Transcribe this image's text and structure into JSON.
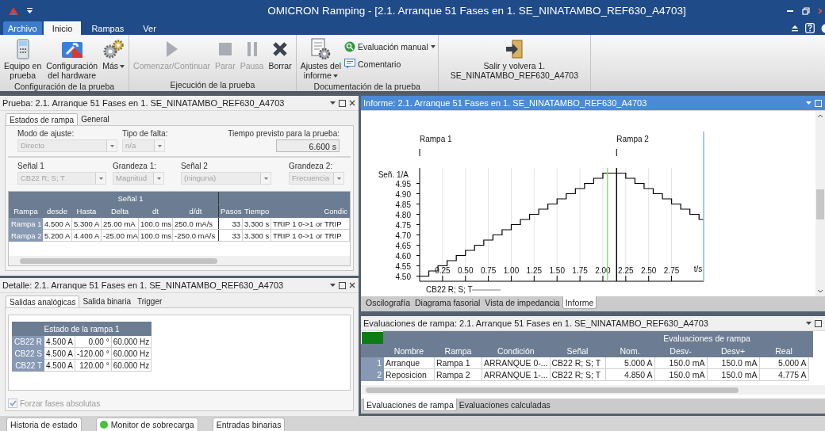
{
  "window": {
    "title": "OMICRON Ramping - [2.1. Arranque 51 Fases en 1. SE_NINATAMBO_REF630_A4703]"
  },
  "ribbon_tabs": [
    {
      "label": "Archivo",
      "kind": "file",
      "selected": false
    },
    {
      "label": "Inicio",
      "kind": "tab",
      "selected": true
    },
    {
      "label": "Rampas",
      "kind": "tab",
      "selected": false
    },
    {
      "label": "Ver",
      "kind": "tab",
      "selected": false
    }
  ],
  "ribbon_groups": [
    {
      "label": "Configuración de la prueba",
      "buttons": [
        {
          "label": "Equipo en\nprueba",
          "kind": "large",
          "disabled": false,
          "dropdown": false
        },
        {
          "label": "Configuración\ndel hardware",
          "kind": "large",
          "disabled": false,
          "dropdown": false
        },
        {
          "label": "Más",
          "kind": "large",
          "disabled": false,
          "dropdown": true
        }
      ]
    },
    {
      "label": "Ejecución de la prueba",
      "buttons": [
        {
          "label": "Comenzar/Continuar",
          "kind": "large",
          "disabled": true,
          "dropdown": false
        },
        {
          "label": "Parar",
          "kind": "large",
          "disabled": true,
          "dropdown": false
        },
        {
          "label": "Pausa",
          "kind": "large",
          "disabled": true,
          "dropdown": false
        },
        {
          "label": "Borrar",
          "kind": "large",
          "disabled": false,
          "dropdown": false
        }
      ]
    },
    {
      "label": "Documentación de la prueba",
      "buttons": [
        {
          "label": "Ajustes del\ninforme",
          "kind": "large",
          "disabled": false,
          "dropdown": true
        },
        {
          "label": "Evaluación manual",
          "kind": "small",
          "disabled": false,
          "dropdown": true
        },
        {
          "label": "Comentario",
          "kind": "small",
          "disabled": false,
          "dropdown": false
        }
      ]
    },
    {
      "buttons": [
        {
          "label": "Salir y volvera 1.\nSE_NINATAMBO_REF630_A4703",
          "kind": "large",
          "disabled": false,
          "dropdown": false
        }
      ]
    }
  ],
  "test_panel": {
    "title": "Prueba: 2.1. Arranque 51 Fases en 1. SE_NINATAMBO_REF630_A4703",
    "active": false,
    "tabs": [
      {
        "label": "Estados de rampa",
        "selected": true
      },
      {
        "label": "General",
        "selected": false
      }
    ],
    "fields_top": [
      {
        "label": "Modo de ajuste:",
        "value": "Directo",
        "kind": "dropdown",
        "disabled": true
      },
      {
        "label": "Tipo de falta:",
        "value": "n/a",
        "kind": "dropdown",
        "disabled": true
      },
      {
        "label": "Tiempo previsto para la prueba:",
        "value": "6.600 s",
        "kind": "readout",
        "disabled": false
      }
    ],
    "fields_bottom": [
      {
        "label": "Señal 1",
        "value": "CB22 R; S; T",
        "kind": "dropdown",
        "disabled": true
      },
      {
        "label": "Grandeza 1:",
        "value": "Magnitud",
        "kind": "dropdown",
        "disabled": true
      },
      {
        "label": "Señal 2",
        "value": "(ninguna)",
        "kind": "dropdown",
        "disabled": true
      },
      {
        "label": "Grandeza 2:",
        "value": "Frecuencia",
        "kind": "dropdown",
        "disabled": true
      }
    ],
    "ramp_table": {
      "group_header": "Señal 1",
      "columns": [
        "Rampa",
        "desde",
        "Hasta",
        "Delta",
        "dt",
        "d/dt",
        "Pasos",
        "Tiempo",
        "Condic"
      ],
      "rows": [
        {
          "cells": [
            "Rampa 1",
            "4.500 A",
            "5.300 A",
            "25.00 mA",
            "100.0 ms",
            "250.0 mA/s",
            "33",
            "3.300 s",
            "TRIP 1 0->1 or TRIP"
          ]
        },
        {
          "cells": [
            "Rampa 2",
            "5.200 A",
            "4.400 A",
            "-25.00 mA",
            "100.0 ms",
            "-250.0 mA/s",
            "33",
            "3.300 s",
            "TRIP 1 0->1 or TRIP"
          ]
        }
      ]
    }
  },
  "detail_panel": {
    "title": "Detalle: 2.1. Arranque 51 Fases en 1. SE_NINATAMBO_REF630_A4703",
    "active": false,
    "tabs": [
      {
        "label": "Salidas analógicas",
        "selected": true
      },
      {
        "label": "Salida binaria",
        "selected": false
      },
      {
        "label": "Trigger",
        "selected": false
      }
    ],
    "state_table": {
      "title": "Estado de la rampa 1",
      "rows": [
        [
          "CB22 R",
          "4.500 A",
          "0.00 °",
          "60.000 Hz"
        ],
        [
          "CB22 S",
          "4.500 A",
          "-120.00 °",
          "60.000 Hz"
        ],
        [
          "CB22 T",
          "4.500 A",
          "120.00 °",
          "60.000 Hz"
        ]
      ]
    },
    "checkbox": {
      "label": "Forzar fases absolutas",
      "checked": true,
      "disabled": true
    }
  },
  "report_panel": {
    "title": "Informe: 2.1. Arranque 51 Fases en 1. SE_NINATAMBO_REF630_A4703",
    "active": true,
    "chart_data": {
      "type": "line",
      "ylabel": "Señ. 1/A",
      "xlabel": "t/s",
      "x": [
        0,
        0.1,
        0.1,
        0.2,
        0.2,
        0.3,
        0.3,
        0.4,
        0.4,
        0.5,
        0.5,
        0.6,
        0.6,
        0.7,
        0.7,
        0.8,
        0.8,
        0.9,
        0.9,
        1.0,
        1.0,
        1.1,
        1.1,
        1.2,
        1.2,
        1.3,
        1.3,
        1.4,
        1.4,
        1.5,
        1.5,
        1.6,
        1.6,
        1.7,
        1.7,
        1.8,
        1.8,
        1.9,
        1.9,
        2.0,
        2.0,
        2.25,
        2.25,
        2.35,
        2.35,
        2.45,
        2.45,
        2.55,
        2.55,
        2.65,
        2.65,
        2.75,
        2.75,
        2.85,
        2.85,
        2.95,
        2.95,
        3.05,
        3.05,
        3.1
      ],
      "series": [
        {
          "name": "CB22 R; S; T",
          "color": "#000000",
          "values": [
            4.5,
            4.5,
            4.525,
            4.525,
            4.55,
            4.55,
            4.575,
            4.575,
            4.6,
            4.6,
            4.625,
            4.625,
            4.65,
            4.65,
            4.675,
            4.675,
            4.7,
            4.7,
            4.725,
            4.725,
            4.75,
            4.75,
            4.775,
            4.775,
            4.8,
            4.8,
            4.825,
            4.825,
            4.85,
            4.85,
            4.875,
            4.875,
            4.9,
            4.9,
            4.925,
            4.925,
            4.95,
            4.95,
            4.975,
            4.975,
            5.0,
            5.0,
            4.975,
            4.975,
            4.95,
            4.95,
            4.925,
            4.925,
            4.9,
            4.9,
            4.875,
            4.875,
            4.85,
            4.85,
            4.825,
            4.825,
            4.8,
            4.8,
            4.775,
            4.775
          ]
        }
      ],
      "xlim": [
        0,
        3.1
      ],
      "ylim": [
        4.475,
        5.025
      ],
      "grid": true,
      "xticks": [
        {
          "value": 0.25,
          "label": "0.25"
        },
        {
          "value": 0.5,
          "label": "0.50"
        },
        {
          "value": 0.75,
          "label": "0.75"
        },
        {
          "value": 1.0,
          "label": "1.00"
        },
        {
          "value": 1.25,
          "label": "1.25"
        },
        {
          "value": 1.5,
          "label": "1.50"
        },
        {
          "value": 1.75,
          "label": "1.75"
        },
        {
          "value": 2.0,
          "label": "2.00"
        },
        {
          "value": 2.25,
          "label": "2.25"
        },
        {
          "value": 2.5,
          "label": "2.50"
        },
        {
          "value": 2.75,
          "label": "2.75"
        }
      ],
      "yticks": [
        {
          "value": 4.5,
          "label": "4.50"
        },
        {
          "value": 4.55,
          "label": "4.55"
        },
        {
          "value": 4.6,
          "label": "4.60"
        },
        {
          "value": 4.65,
          "label": "4.65"
        },
        {
          "value": 4.7,
          "label": "4.70"
        },
        {
          "value": 4.75,
          "label": "4.75"
        },
        {
          "value": 4.8,
          "label": "4.80"
        },
        {
          "value": 4.85,
          "label": "4.85"
        },
        {
          "value": 4.9,
          "label": "4.90"
        },
        {
          "value": 4.95,
          "label": "4.95"
        }
      ],
      "annotations": [
        "Rampa 1",
        "Rampa 2"
      ],
      "ref_lines": [
        {
          "axis": "x",
          "value": 2.05,
          "color": "#7ee26b"
        },
        {
          "axis": "x",
          "value": 2.15,
          "color": "#000000"
        },
        {
          "axis": "x",
          "value": 3.1,
          "color": "#7ab8ea"
        }
      ]
    },
    "tabs": [
      {
        "label": "Oscilografía",
        "selected": false
      },
      {
        "label": "Diagrama fasorial",
        "selected": false
      },
      {
        "label": "Vista de impedancia",
        "selected": false
      },
      {
        "label": "Informe",
        "selected": true
      }
    ]
  },
  "eval_panel": {
    "title": "Evaluaciones de rampa: 2.1. Arranque 51 Fases en 1. SE_NINATAMBO_REF630_A4703",
    "active": false,
    "result_indicator": {
      "color": "#0b7d14"
    },
    "group_header": "Evaluaciones de rampa",
    "columns": [
      "Nombre",
      "Rampa",
      "Condición",
      "Señal",
      "Nom.",
      "Desv-",
      "Desv+",
      "Real"
    ],
    "rows": [
      {
        "index": "1",
        "cells": [
          "Arranque",
          "Rampa 1",
          "ARRANQUE 0-...",
          "CB22 R; S; T",
          "5.000 A",
          "150.0 mA",
          "150.0 mA",
          "5.000 A"
        ]
      },
      {
        "index": "2",
        "cells": [
          "Reposicion",
          "Rampa 2",
          "ARRANQUE 1-...",
          "CB22 R; S; T",
          "4.850 A",
          "150.0 mA",
          "150.0 mA",
          "4.775 A"
        ]
      }
    ],
    "tabs": [
      {
        "label": "Evaluaciones de rampa",
        "selected": true
      },
      {
        "label": "Evaluaciones calculadas",
        "selected": false
      }
    ]
  },
  "status_tabs": [
    {
      "label": "Historia de estado"
    },
    {
      "label": "Monitor de sobrecarga",
      "color": "#44c23a"
    },
    {
      "label": "Entradas binarias"
    }
  ]
}
